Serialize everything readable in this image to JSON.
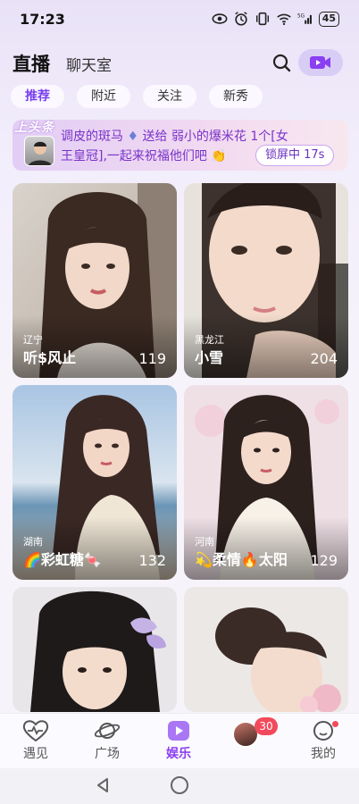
{
  "status_bar": {
    "time": "17:23",
    "battery": "45"
  },
  "header": {
    "title": "直播",
    "subtitle": "聊天室"
  },
  "tabs": [
    {
      "label": "推荐",
      "active": true
    },
    {
      "label": "附近",
      "active": false
    },
    {
      "label": "关注",
      "active": false
    },
    {
      "label": "新秀",
      "active": false
    }
  ],
  "banner": {
    "tag": "上头条",
    "sender": "调皮的斑马",
    "gift_text": "送给 弱小的爆米花 1个[女",
    "line2": "王皇冠],一起来祝福他们吧",
    "lock_label": "锁屏中 17s"
  },
  "cards": [
    {
      "province": "辽宁",
      "name": "听$风止",
      "count": "119"
    },
    {
      "province": "黑龙江",
      "name": "小雪",
      "count": "204"
    },
    {
      "province": "湖南",
      "name": "🌈彩虹糖🍬",
      "count": "132"
    },
    {
      "province": "河南",
      "name": "💫柔情🔥太阳",
      "count": "129"
    },
    {
      "province": "",
      "name": "",
      "count": ""
    },
    {
      "province": "",
      "name": "",
      "count": ""
    }
  ],
  "bottom_nav": [
    {
      "label": "遇见",
      "icon": "heart-pulse-icon"
    },
    {
      "label": "广场",
      "icon": "planet-icon"
    },
    {
      "label": "娱乐",
      "icon": "play-icon",
      "active": true
    },
    {
      "label": "",
      "icon": "avatar"
    },
    {
      "label": "我的",
      "icon": "face-icon"
    }
  ],
  "message_badge": "30",
  "colors": {
    "accent": "#8a3ff2",
    "badge": "#f24a5c"
  }
}
